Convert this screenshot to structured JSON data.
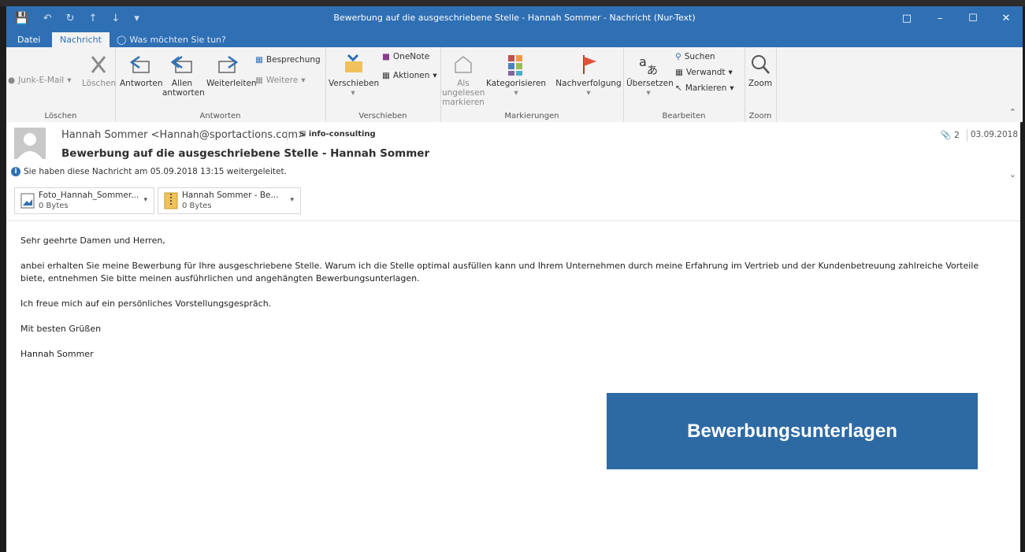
{
  "colors": {
    "accent": "#2f6fb4",
    "banner": "#2d6aa4"
  },
  "titlebar": {
    "title": "Bewerbung auf die ausgeschriebene Stelle - Hannah Sommer - Nachricht (Nur-Text)",
    "qat_icons": [
      "save-icon",
      "undo-icon",
      "redo-icon",
      "up-icon",
      "down-icon",
      "customize-icon"
    ]
  },
  "tabs": [
    {
      "label": "Datei"
    },
    {
      "label": "Nachricht"
    }
  ],
  "tell_me": "Was möchten Sie tun?",
  "ribbon": {
    "loeschen": {
      "junk": "Junk-E-Mail",
      "delete": "Löschen",
      "group": "Löschen"
    },
    "antworten": {
      "reply": "Antworten",
      "reply_all": "Allen antworten",
      "forward": "Weiterleiten",
      "meeting": "Besprechung",
      "more": "Weitere",
      "group": "Antworten"
    },
    "verschieben": {
      "move": "Verschieben",
      "onenote": "OneNote",
      "actions": "Aktionen",
      "group": "Verschieben"
    },
    "markierungen": {
      "unread": "Als ungelesen markieren",
      "categorize": "Kategorisieren",
      "followup": "Nachverfolgung",
      "group": "Markierungen"
    },
    "bearbeiten": {
      "translate": "Übersetzen",
      "search": "Suchen",
      "related": "Verwandt",
      "select": "Markieren",
      "group": "Bearbeiten"
    },
    "zoom": {
      "zoom": "Zoom",
      "group": "Zoom"
    }
  },
  "message": {
    "sender": "Hannah Sommer <Hannah@sportactions.com>",
    "folder": "info-consulting",
    "subject": "Bewerbung auf die ausgeschriebene Stelle - Hannah Sommer",
    "attachment_count": "2",
    "date": "03.09.2018",
    "info": "Sie haben diese Nachricht am 05.09.2018 13:15 weitergeleitet.",
    "attachments": [
      {
        "name": "Foto_Hannah_Sommer...",
        "size": "0 Bytes"
      },
      {
        "name": "Hannah Sommer - Be...",
        "size": "0 Bytes"
      }
    ],
    "body": [
      "Sehr geehrte Damen und Herren,",
      "anbei erhalten Sie meine Bewerbung für Ihre ausgeschriebene Stelle. Warum ich die Stelle optimal ausfüllen kann und Ihrem Unternehmen durch meine Erfahrung im Vertrieb und der Kundenbetreuung zahlreiche Vorteile biete, entnehmen Sie bitte meinen ausführlichen und angehängten Bewerbungsunterlagen.",
      "Ich freue mich auf ein persönliches Vorstellungsgespräch.",
      "Mit besten Grüßen",
      "Hannah Sommer"
    ]
  },
  "banner": "Bewerbungsunterlagen"
}
